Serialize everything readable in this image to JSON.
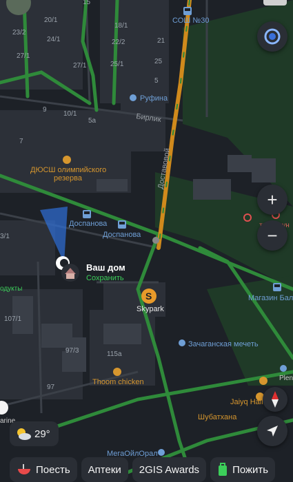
{
  "map": {
    "streets": {
      "dostykovoy": "Доставовой",
      "birlik": "Бирлик"
    },
    "places": {
      "school": "СОШ №30",
      "rufina": "Руфина",
      "dyussh": "ДЮСШ олимпийского",
      "dyussh2": "резерва",
      "dospanova1": "Доспанова",
      "dospanova2": "Доспанова",
      "skypark": "Skypark",
      "mosque": "Зачаганская мечеть",
      "magazin": "Магазин Бал",
      "travmpunkt": "травмпун",
      "thoom": "Thoom chicken",
      "jaiyq": "Jaiyq Hall",
      "shubatkhana": "Шубатхана",
      "megaoil": "МегаОйлОрал",
      "products": "одукты",
      "marine": "arine",
      "plen": "Plen"
    },
    "house_numbers": [
      "23/2",
      "20/1",
      "18/1",
      "24/1",
      "22/2",
      "27/1",
      "27/1",
      "25/1",
      "9",
      "10/1",
      "5a",
      "7",
      "3/1",
      "107/1",
      "97/3",
      "115a",
      "97",
      "21",
      "25",
      "5",
      "15"
    ]
  },
  "home": {
    "name": "Ваш дом",
    "action": "Сохранить"
  },
  "weather": {
    "temperature": "29°",
    "icon": "partly-cloudy-icon"
  },
  "chips": [
    {
      "label": "Поесть",
      "icon": "food-bowl-icon"
    },
    {
      "label": "Аптеки",
      "icon": ""
    },
    {
      "label": "2GIS Awards",
      "icon": ""
    },
    {
      "label": "Пожить",
      "icon": "suitcase-icon"
    }
  ],
  "controls": {
    "zoom_in": "+",
    "zoom_out": "−"
  },
  "colors": {
    "background": "#1d2127",
    "road_green": "#2f8a3a",
    "road_orange": "#d08a1c",
    "accent_green": "#3ccf5a",
    "poi_blue": "#6f9fd6"
  }
}
